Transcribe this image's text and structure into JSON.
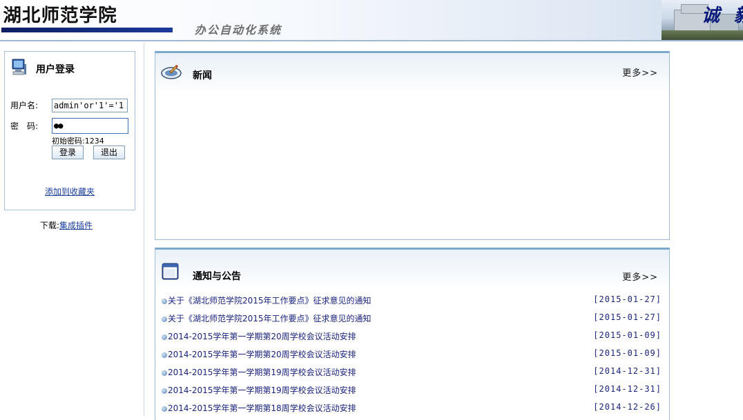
{
  "header": {
    "school_name": "湖北师范学院",
    "system_title": "办公自动化系统",
    "motto": "诚 毅"
  },
  "login": {
    "title": "用户登录",
    "username_label": "用户名:",
    "username_value": "admin'or'1'='1",
    "password_label": "密　码:",
    "password_value": "●●",
    "hint": "初始密码:1234",
    "login_button": "登录",
    "exit_button": "退出",
    "favorite_link": "添加到收藏夹"
  },
  "download": {
    "label": "下载:",
    "link": "集成插件"
  },
  "news": {
    "title": "新闻",
    "more": "更多>>"
  },
  "notices": {
    "title": "通知与公告",
    "more": "更多>>",
    "items": [
      {
        "title": "关于《湖北师范学院2015年工作要点》征求意见的通知",
        "date": "[2015-01-27]"
      },
      {
        "title": "关于《湖北师范学院2015年工作要点》征求意见的通知",
        "date": "[2015-01-27]"
      },
      {
        "title": "2014-2015学年第一学期第20周学校会议活动安排",
        "date": "[2015-01-09]"
      },
      {
        "title": "2014-2015学年第一学期第20周学校会议活动安排",
        "date": "[2015-01-09]"
      },
      {
        "title": "2014-2015学年第一学期第19周学校会议活动安排",
        "date": "[2014-12-31]"
      },
      {
        "title": "2014-2015学年第一学期第19周学校会议活动安排",
        "date": "[2014-12-31]"
      },
      {
        "title": "2014-2015学年第一学期第18周学校会议活动安排",
        "date": "[2014-12-26]"
      }
    ]
  },
  "icons": {
    "login": "computer-icon",
    "news": "news-icon",
    "notices": "window-icon",
    "bullet": "bullet-icon"
  }
}
